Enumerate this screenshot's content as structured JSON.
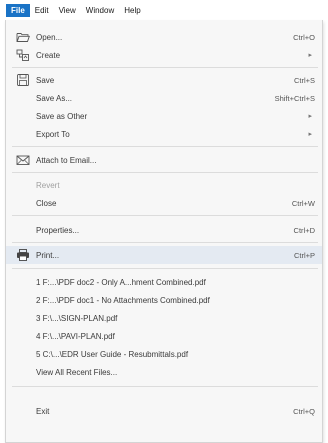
{
  "menubar": {
    "file": "File",
    "edit": "Edit",
    "view": "View",
    "window": "Window",
    "help": "Help"
  },
  "menu": {
    "open": {
      "label": "Open...",
      "shortcut": "Ctrl+O"
    },
    "create": {
      "label": "Create"
    },
    "save": {
      "label": "Save",
      "shortcut": "Ctrl+S"
    },
    "save_as": {
      "label": "Save As...",
      "shortcut": "Shift+Ctrl+S"
    },
    "save_as_other": {
      "label": "Save as Other"
    },
    "export_to": {
      "label": "Export To"
    },
    "attach_to_email": {
      "label": "Attach to Email..."
    },
    "revert": {
      "label": "Revert"
    },
    "close": {
      "label": "Close",
      "shortcut": "Ctrl+W"
    },
    "properties": {
      "label": "Properties...",
      "shortcut": "Ctrl+D"
    },
    "print": {
      "label": "Print...",
      "shortcut": "Ctrl+P"
    },
    "recent_files": [
      "1 F:...\\PDF doc2 - Only A...hment Combined.pdf",
      "2 F:...\\PDF doc1 - No Attachments Combined.pdf",
      "3 F:\\...\\SIGN-PLAN.pdf",
      "4 F:\\...\\PAVI-PLAN.pdf",
      "5 C:\\...\\EDR User Guide - Resubmittals.pdf"
    ],
    "view_all_recent": {
      "label": "View All Recent Files..."
    },
    "exit": {
      "label": "Exit",
      "shortcut": "Ctrl+Q"
    }
  },
  "icons": {
    "open": "folder-open-icon",
    "create": "create-pdf-icon",
    "save": "floppy-disk-icon",
    "attach": "email-envelope-icon",
    "print": "printer-icon"
  },
  "colors": {
    "active_menu": "#1a73c6",
    "hover_row": "#e4eaf2",
    "menu_bg": "#f7f7f7"
  }
}
